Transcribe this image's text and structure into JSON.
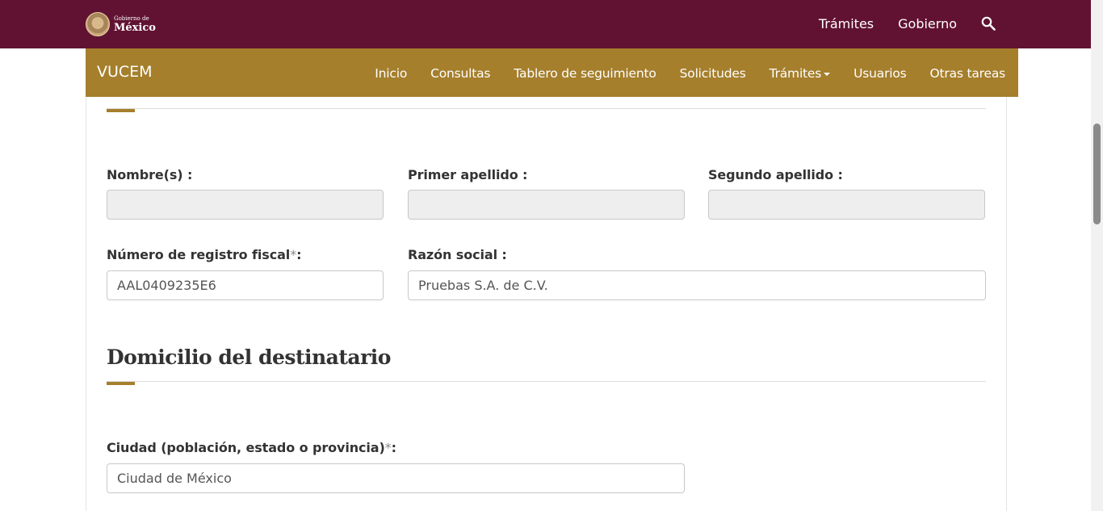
{
  "header": {
    "logo_small": "Gobierno de",
    "logo_big": "México",
    "nav": [
      "Trámites",
      "Gobierno"
    ]
  },
  "vucem": {
    "brand": "VUCEM",
    "nav": [
      "Inicio",
      "Consultas",
      "Tablero de seguimiento",
      "Solicitudes",
      "Trámites",
      "Usuarios",
      "Otras tareas"
    ]
  },
  "form": {
    "nombre_label": "Nombre(s) :",
    "nombre_value": "",
    "primer_apellido_label": "Primer apellido :",
    "primer_apellido_value": "",
    "segundo_apellido_label": "Segundo apellido :",
    "segundo_apellido_value": "",
    "rfc_label": "Número de registro fiscal",
    "rfc_value": "AAL0409235E6",
    "razon_label": "Razón social :",
    "razon_value": "Pruebas S.A. de C.V.",
    "required_mark": "*",
    "required_suffix": ":",
    "domicilio_title": "Domicilio del destinatario",
    "ciudad_label": "Ciudad (población, estado o provincia)",
    "ciudad_value": "Ciudad de México"
  },
  "colors": {
    "gob_bar": "#611232",
    "vucem_bar": "#a57f2c",
    "accent": "#a57f2c"
  }
}
